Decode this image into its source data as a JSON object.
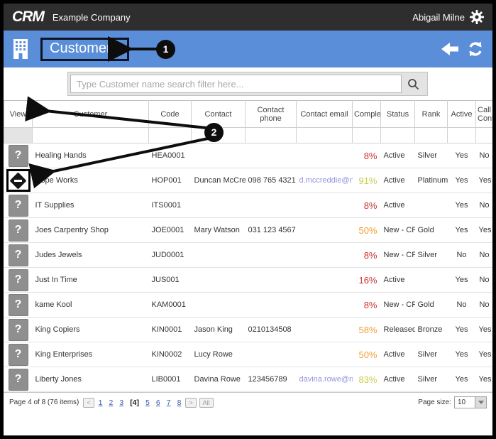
{
  "topbar": {
    "logo": "CRM",
    "company": "Example Company",
    "user": "Abigail Milne"
  },
  "titlebar": {
    "title": "Customers"
  },
  "icons": {
    "gear": "gear-icon",
    "building": "building-icon",
    "back": "back-arrow-icon",
    "refresh": "refresh-icon",
    "search": "search-icon",
    "view_placeholder_glyph": "?"
  },
  "search": {
    "placeholder": "Type Customer name search filter here..."
  },
  "annotations": {
    "callout1": "1",
    "callout2": "2"
  },
  "table": {
    "columns": [
      "View",
      "Customer",
      "Code",
      "Contact",
      "Contact phone",
      "Contact email",
      "Complete",
      "Status",
      "Rank",
      "Active",
      "Call Contact"
    ],
    "rows": [
      {
        "view": "question",
        "customer": "Healing Hands",
        "code": "HEA0001",
        "contact": "",
        "phone": "",
        "email": "",
        "complete": "8%",
        "complete_color": "red",
        "status": "Active",
        "rank": "Silver",
        "active": "Yes",
        "call": "No"
      },
      {
        "view": "loading",
        "customer": "Hope Works",
        "code": "HOP001",
        "contact": "Duncan McCreddie",
        "phone": "098 765 4321",
        "email": "d.mccreddie@noem",
        "complete": "91%",
        "complete_color": "yellow",
        "status": "Active",
        "rank": "Platinum",
        "active": "Yes",
        "call": "Yes"
      },
      {
        "view": "question",
        "customer": "IT Supplies",
        "code": "ITS0001",
        "contact": "",
        "phone": "",
        "email": "",
        "complete": "8%",
        "complete_color": "red",
        "status": "Active",
        "rank": "",
        "active": "Yes",
        "call": "No"
      },
      {
        "view": "question",
        "customer": "Joes Carpentry Shop",
        "code": "JOE0001",
        "contact": "Mary Watson",
        "phone": "031 123 4567",
        "email": "",
        "complete": "50%",
        "complete_color": "orange",
        "status": "New - CRM",
        "rank": "Gold",
        "active": "Yes",
        "call": "Yes"
      },
      {
        "view": "question",
        "customer": "Judes Jewels",
        "code": "JUD0001",
        "contact": "",
        "phone": "",
        "email": "",
        "complete": "8%",
        "complete_color": "red",
        "status": "New - CRM",
        "rank": "Silver",
        "active": "No",
        "call": "No"
      },
      {
        "view": "question",
        "customer": "Just In Time",
        "code": "JUS001",
        "contact": "",
        "phone": "",
        "email": "",
        "complete": "16%",
        "complete_color": "red",
        "status": "Active",
        "rank": "",
        "active": "Yes",
        "call": "No"
      },
      {
        "view": "question",
        "customer": "kame Kool",
        "code": "KAM0001",
        "contact": "",
        "phone": "",
        "email": "",
        "complete": "8%",
        "complete_color": "red",
        "status": "New - CRM",
        "rank": "Gold",
        "active": "No",
        "call": "No"
      },
      {
        "view": "question",
        "customer": "King Copiers",
        "code": "KIN0001",
        "contact": "Jason King",
        "phone": "0210134508",
        "email": "",
        "complete": "58%",
        "complete_color": "orange",
        "status": "Released",
        "rank": "Bronze",
        "active": "Yes",
        "call": "Yes"
      },
      {
        "view": "question",
        "customer": "King Enterprises",
        "code": "KIN0002",
        "contact": "Lucy Rowe",
        "phone": "",
        "email": "",
        "complete": "50%",
        "complete_color": "orange",
        "status": "Active",
        "rank": "Silver",
        "active": "Yes",
        "call": "Yes"
      },
      {
        "view": "question",
        "customer": "Liberty Jones",
        "code": "LIB0001",
        "contact": "Davina Rowe",
        "phone": "123456789",
        "email": "davina.rowe@noem",
        "complete": "83%",
        "complete_color": "yellow",
        "status": "Active",
        "rank": "Silver",
        "active": "Yes",
        "call": "Yes"
      }
    ]
  },
  "footer": {
    "summary": "Page 4 of 8 (76 items)",
    "prev": "<",
    "next": ">",
    "all": "All",
    "pages": [
      {
        "label": "1",
        "current": false
      },
      {
        "label": "2",
        "current": false
      },
      {
        "label": "3",
        "current": false
      },
      {
        "label": "[4]",
        "current": true
      },
      {
        "label": "5",
        "current": false
      },
      {
        "label": "6",
        "current": false
      },
      {
        "label": "7",
        "current": false
      },
      {
        "label": "8",
        "current": false
      }
    ],
    "page_size_label": "Page size:",
    "page_size": "10"
  },
  "colors": {
    "red": "#cc3333",
    "orange": "#f0a030",
    "yellow": "#c9cf4a",
    "link": "#9493e0",
    "accent_blue": "#5a8ed8"
  }
}
